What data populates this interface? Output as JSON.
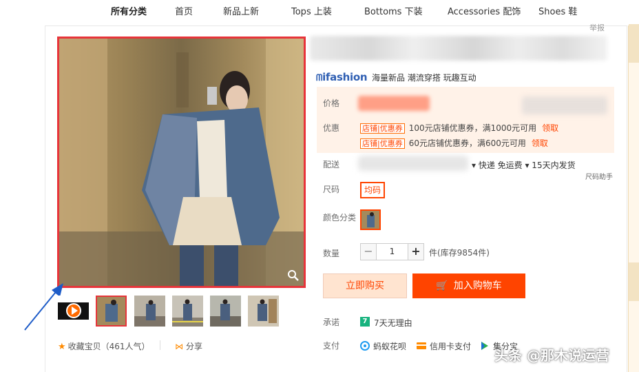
{
  "nav": {
    "items": [
      "所有分类",
      "首页",
      "新品上新",
      "Tops 上装",
      "Bottoms 下装",
      "Accessories 配饰",
      "Shoes 鞋"
    ]
  },
  "report_label": "举报",
  "gallery": {
    "thumbnail_count": 6,
    "favorite_label": "收藏宝贝（461人气）",
    "share_label": "分享"
  },
  "brand": {
    "logo": "ifashion",
    "slogan": "海量新品 潮流穿搭 玩趣互动"
  },
  "labels": {
    "price": "价格",
    "promo": "优惠",
    "delivery": "配送",
    "size": "尺码",
    "color": "颜色分类",
    "quantity": "数量",
    "promise": "承诺",
    "payment": "支付"
  },
  "coupons": [
    {
      "tag": "店铺|优惠券",
      "text": "100元店铺优惠券，满1000元可用",
      "link": "领取"
    },
    {
      "tag": "店铺|优惠券",
      "text": "60元店铺优惠券，满600元可用",
      "link": "领取"
    }
  ],
  "delivery": {
    "text": "▾  快递 免运费 ▾  15天内发货",
    "size_helper": "尺码助手"
  },
  "size": {
    "selected": "均码"
  },
  "quantity": {
    "value": "1",
    "minus": "−",
    "plus": "+",
    "stock_text": "件(库存9854件)"
  },
  "buttons": {
    "buy_now": "立即购买",
    "add_cart": "加入购物车"
  },
  "promise": {
    "icon_text": "7",
    "text": "7天无理由"
  },
  "payment": {
    "methods": [
      "蚂蚁花呗",
      "信用卡支付",
      "集分宝"
    ]
  },
  "watermark": "头条 @那木说运营",
  "colors": {
    "accent": "#ff4400",
    "highlight_border": "#e7343a",
    "brand_blue": "#2f5fb3",
    "promise_green": "#17b37e"
  }
}
